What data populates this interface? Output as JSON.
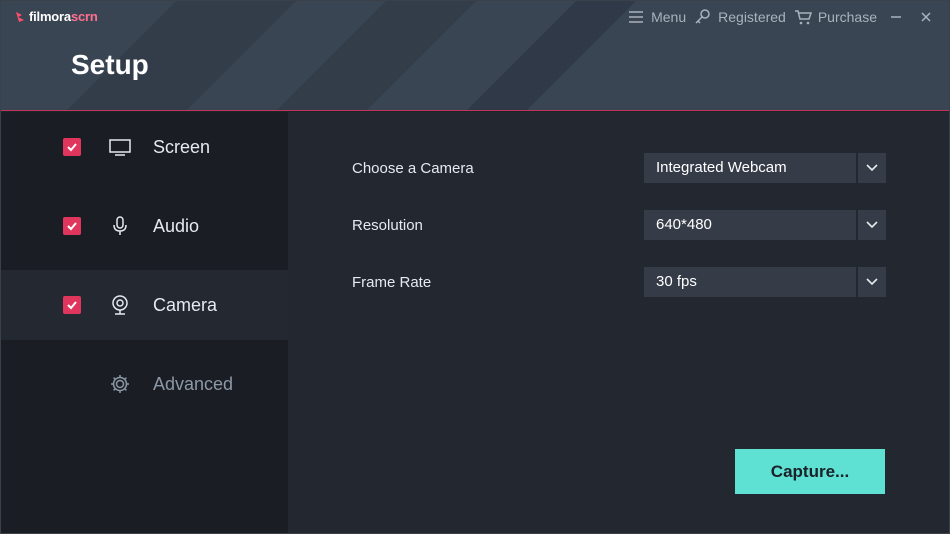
{
  "app": {
    "logo_main": "filmora",
    "logo_accent": "scrn",
    "page_title": "Setup"
  },
  "topnav": {
    "menu_label": "Menu",
    "registered_label": "Registered",
    "purchase_label": "Purchase"
  },
  "sidebar": {
    "items": [
      {
        "label": "Screen",
        "checked": true,
        "icon": "monitor-icon"
      },
      {
        "label": "Audio",
        "checked": true,
        "icon": "microphone-icon"
      },
      {
        "label": "Camera",
        "checked": true,
        "icon": "webcam-icon",
        "active": true
      },
      {
        "label": "Advanced",
        "checked": false,
        "icon": "gear-icon"
      }
    ]
  },
  "camera": {
    "choose_label": "Choose a Camera",
    "choose_value": "Integrated Webcam",
    "resolution_label": "Resolution",
    "resolution_value": "640*480",
    "framerate_label": "Frame Rate",
    "framerate_value": "30 fps"
  },
  "actions": {
    "capture_label": "Capture..."
  },
  "colors": {
    "accent_pink": "#e0365e",
    "capture_teal": "#5ee0d2",
    "header_bg": "#3a4553"
  }
}
